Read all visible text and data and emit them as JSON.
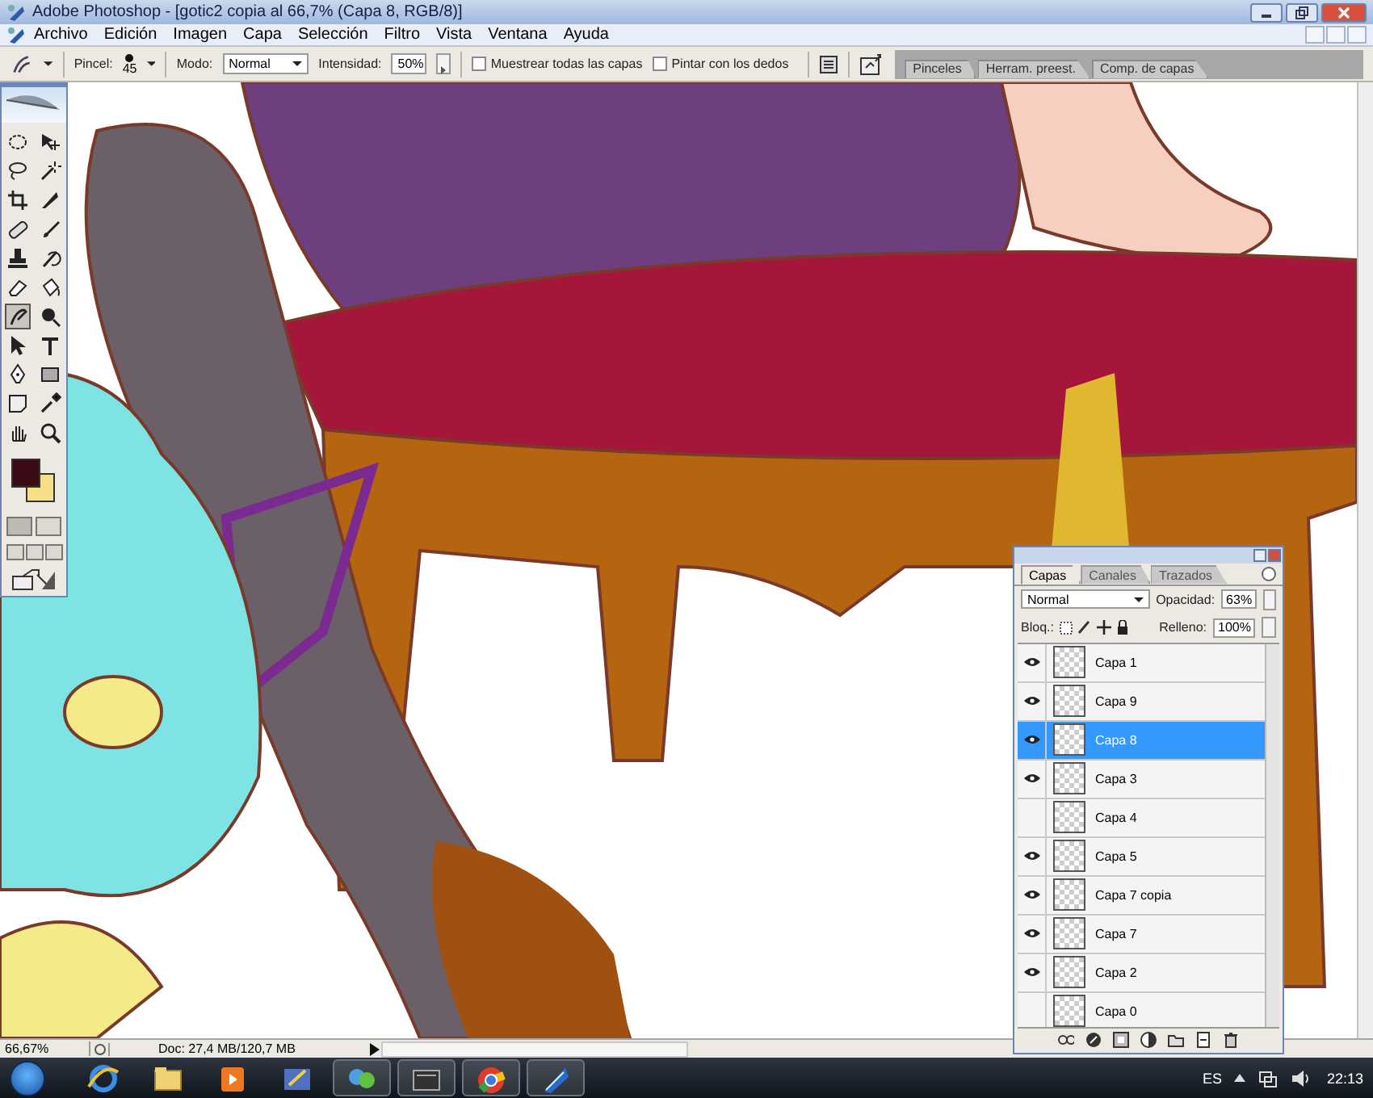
{
  "window": {
    "title": "Adobe Photoshop - [gotic2 copia al 66,7% (Capa 8, RGB/8)]"
  },
  "menu": [
    "Archivo",
    "Edición",
    "Imagen",
    "Capa",
    "Selección",
    "Filtro",
    "Vista",
    "Ventana",
    "Ayuda"
  ],
  "options_bar": {
    "brush_label": "Pincel:",
    "brush_size": "45",
    "mode_label": "Modo:",
    "mode": "Normal",
    "strength_label": "Intensidad:",
    "strength": "50%",
    "checkboxes": [
      {
        "label": "Muestrear todas las capas",
        "checked": false
      },
      {
        "label": "Pintar con los dedos",
        "checked": false
      }
    ]
  },
  "palette_well": {
    "tabs": [
      "Pinceles",
      "Herram. preest.",
      "Comp. de capas"
    ]
  },
  "toolbox": {
    "tools": [
      {
        "kind": "marquee",
        "selected": false
      },
      {
        "kind": "move",
        "selected": false
      },
      {
        "kind": "lasso",
        "selected": false
      },
      {
        "kind": "wand",
        "selected": false
      },
      {
        "kind": "crop",
        "selected": false
      },
      {
        "kind": "slice",
        "selected": false
      },
      {
        "kind": "healing",
        "selected": false
      },
      {
        "kind": "brush",
        "selected": false
      },
      {
        "kind": "stamp",
        "selected": false
      },
      {
        "kind": "history",
        "selected": false
      },
      {
        "kind": "eraser",
        "selected": false
      },
      {
        "kind": "bucket",
        "selected": false
      },
      {
        "kind": "smudge",
        "selected": true
      },
      {
        "kind": "dodge",
        "selected": false
      },
      {
        "kind": "arrow",
        "selected": false
      },
      {
        "kind": "type",
        "selected": false
      },
      {
        "kind": "pen",
        "selected": false
      },
      {
        "kind": "shape",
        "selected": false
      },
      {
        "kind": "note",
        "selected": false
      },
      {
        "kind": "eyedropper",
        "selected": false
      },
      {
        "kind": "hand",
        "selected": false
      },
      {
        "kind": "zoom",
        "selected": false
      }
    ],
    "swatches": [
      {
        "kind": "foreground",
        "color": "#3c0b16"
      },
      {
        "kind": "background",
        "color": "#f6df86"
      }
    ]
  },
  "layers_panel": {
    "tabs": [
      {
        "label": "Capas",
        "selected": true
      },
      {
        "label": "Canales",
        "selected": false
      },
      {
        "label": "Trazados",
        "selected": false
      }
    ],
    "blend_mode": "Normal",
    "opacity_label": "Opacidad:",
    "opacity": "63%",
    "lock_label": "Bloq.:",
    "fill_label": "Relleno:",
    "fill": "100%",
    "layers": [
      {
        "name": "Capa 1",
        "visible": true,
        "selected": false
      },
      {
        "name": "Capa 9",
        "visible": true,
        "selected": false
      },
      {
        "name": "Capa 8",
        "visible": true,
        "selected": true
      },
      {
        "name": "Capa 3",
        "visible": true,
        "selected": false
      },
      {
        "name": "Capa 4",
        "visible": false,
        "selected": false
      },
      {
        "name": "Capa 5",
        "visible": true,
        "selected": false
      },
      {
        "name": "Capa 7 copia",
        "visible": true,
        "selected": false
      },
      {
        "name": "Capa 7",
        "visible": true,
        "selected": false
      },
      {
        "name": "Capa 2",
        "visible": true,
        "selected": false
      },
      {
        "name": "Capa 0",
        "visible": false,
        "selected": false
      }
    ]
  },
  "status_bar": {
    "zoom": "66,67%",
    "doc": "Doc: 27,4 MB/120,7 MB"
  },
  "taskbar": {
    "language": "ES",
    "time": "22:13"
  }
}
